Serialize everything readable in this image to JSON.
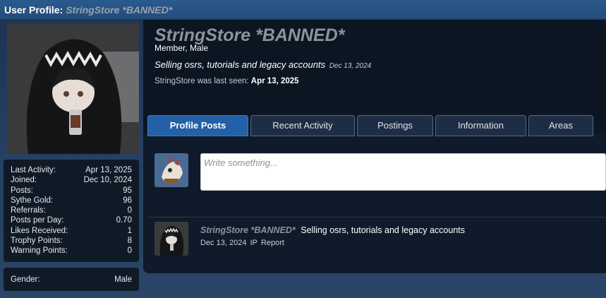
{
  "titlebar": {
    "label": "User Profile:",
    "username": "StringStore *BANNED*"
  },
  "profile": {
    "username": "StringStore *BANNED*",
    "user_title": "Member, Male",
    "status_text": "Selling osrs, tutorials and legacy accounts",
    "status_date": "Dec 13, 2024",
    "last_seen_prefix": "StringStore was last seen:",
    "last_seen_date": "Apr 13, 2025"
  },
  "stats": [
    {
      "label": "Last Activity:",
      "value": "Apr 13, 2025"
    },
    {
      "label": "Joined:",
      "value": "Dec 10, 2024"
    },
    {
      "label": "Posts:",
      "value": "95"
    },
    {
      "label": "Sythe Gold:",
      "value": "96"
    },
    {
      "label": "Referrals:",
      "value": "0"
    },
    {
      "label": "Posts per Day:",
      "value": "0.70"
    },
    {
      "label": "Likes Received:",
      "value": "1"
    },
    {
      "label": "Trophy Points:",
      "value": "8"
    },
    {
      "label": "Warning Points:",
      "value": "0"
    }
  ],
  "gender": {
    "label": "Gender:",
    "value": "Male"
  },
  "tabs": [
    {
      "label": "Profile Posts",
      "active": true
    },
    {
      "label": "Recent Activity",
      "active": false
    },
    {
      "label": "Postings",
      "active": false
    },
    {
      "label": "Information",
      "active": false
    },
    {
      "label": "Areas",
      "active": false
    }
  ],
  "composer": {
    "placeholder": "Write something..."
  },
  "post": {
    "author": "StringStore *BANNED*",
    "message": "Selling osrs, tutorials and legacy accounts",
    "date": "Dec 13, 2024",
    "ip_label": "IP",
    "report_label": "Report"
  },
  "colors": {
    "accent": "#2360a8",
    "banned_name": "#8c939b",
    "panel": "#0f1b2a"
  },
  "icons": {
    "profile_avatar": "hooded-character-avatar",
    "composer_avatar": "creature-avatar",
    "post_avatar": "hooded-character-avatar"
  }
}
